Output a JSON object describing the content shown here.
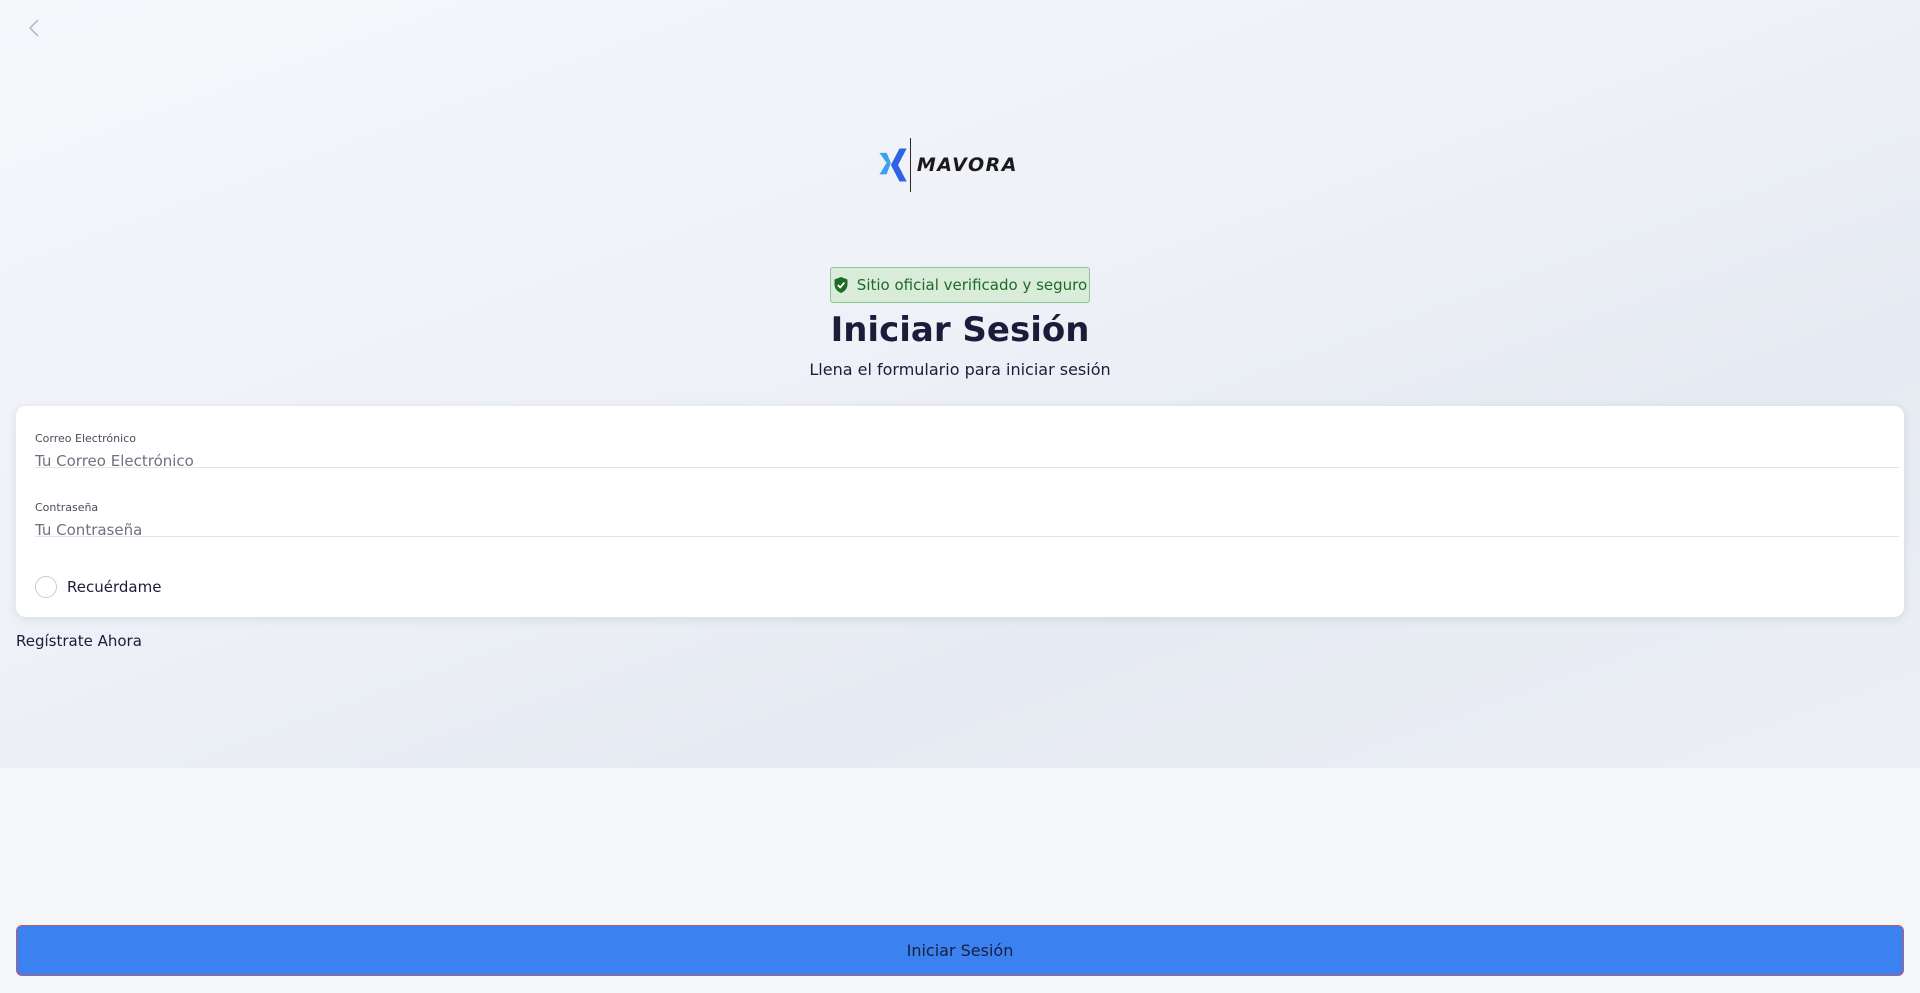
{
  "brand": {
    "name": "MAVORA",
    "colors": {
      "mark_light": "#3aa0f0",
      "mark_dark": "#2f62e8"
    }
  },
  "nav": {
    "back_icon": "chevron-left-icon"
  },
  "verified_badge": {
    "text": "Sitio oficial verificado y seguro",
    "icon": "shield-check-icon",
    "color": "#1d6b25"
  },
  "header": {
    "title": "Iniciar Sesión",
    "subtitle": "Llena el formulario para iniciar sesión"
  },
  "form": {
    "email": {
      "label": "Correo Electrónico",
      "placeholder": "Tu Correo Electrónico",
      "value": ""
    },
    "password": {
      "label": "Contraseña",
      "placeholder": "Tu Contraseña",
      "value": ""
    },
    "remember": {
      "label": "Recuérdame",
      "checked": false
    }
  },
  "register_link": "Regístrate Ahora",
  "submit": {
    "label": "Iniciar Sesión",
    "color": "#3b82f0"
  }
}
